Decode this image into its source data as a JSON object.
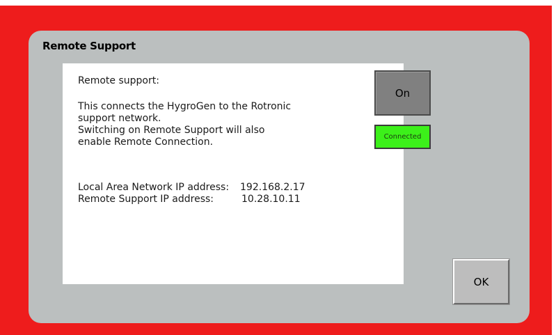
{
  "dialog": {
    "title": "Remote Support",
    "ok_label": "OK"
  },
  "panel": {
    "heading": "Remote support:",
    "description": "This connects the HygroGen to the Rotronic\nsupport network.\nSwitching on Remote Support will also\nenable Remote Connection.",
    "lan_ip_label": "Local Area Network IP address:",
    "lan_ip_value": "192.168.2.17",
    "remote_ip_label": "Remote Support IP address:",
    "remote_ip_value": "10.28.10.11"
  },
  "remote_support": {
    "toggle_label": "On",
    "status_label": "Connected",
    "status_color": "#3cf01a"
  },
  "colors": {
    "frame": "#ee1c1c",
    "dialog": "#bbbfbf",
    "panel": "#ffffff"
  }
}
